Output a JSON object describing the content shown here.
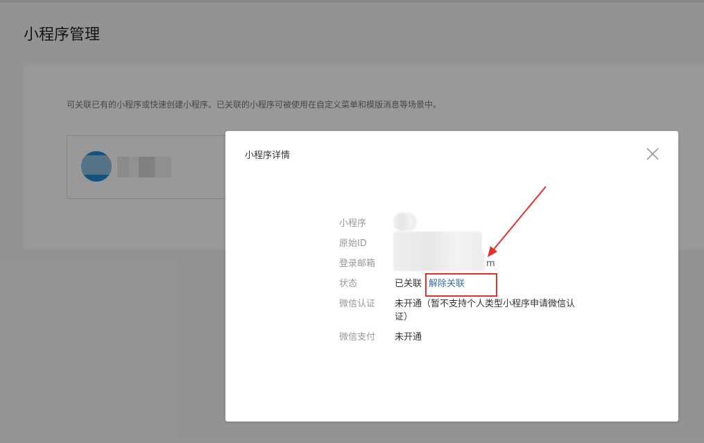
{
  "page": {
    "title": "小程序管理",
    "description": "可关联已有的小程序或快速创建小程序。已关联的小程序可被使用在自定义菜单和模版消息等场景中。"
  },
  "modal": {
    "title": "小程序详情",
    "close_icon": "close-icon",
    "fields": {
      "mini_program_label": "小程序",
      "origin_id_label": "原始ID",
      "login_email_label": "登录邮箱",
      "email_tail": "m",
      "status_label": "状态",
      "status_value": "已关联",
      "unlink_label": "解除关联",
      "wechat_cert_label": "微信认证",
      "wechat_cert_value": "未开通（暂不支持个人类型小程序申请微信认证）",
      "wechat_pay_label": "微信支付",
      "wechat_pay_value": "未开通"
    }
  },
  "annotation": {
    "highlight_color": "#e0312d"
  }
}
